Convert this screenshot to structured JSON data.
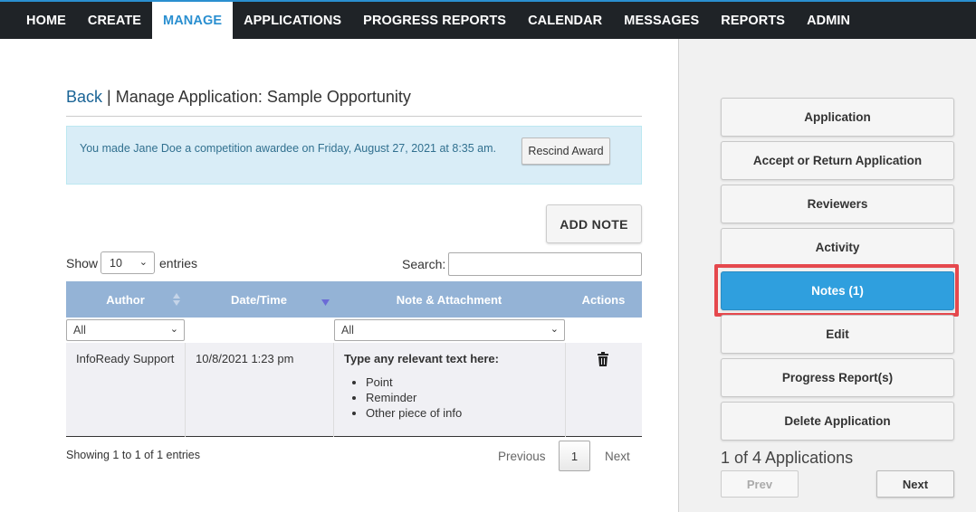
{
  "nav": {
    "items": [
      {
        "label": "HOME",
        "active": false
      },
      {
        "label": "CREATE",
        "active": false
      },
      {
        "label": "MANAGE",
        "active": true
      },
      {
        "label": "APPLICATIONS",
        "active": false
      },
      {
        "label": "PROGRESS REPORTS",
        "active": false
      },
      {
        "label": "CALENDAR",
        "active": false
      },
      {
        "label": "MESSAGES",
        "active": false
      },
      {
        "label": "REPORTS",
        "active": false
      },
      {
        "label": "ADMIN",
        "active": false
      }
    ]
  },
  "page": {
    "back_label": "Back",
    "separator": " | ",
    "title": "Manage Application: Sample Opportunity"
  },
  "alert": {
    "text": "You made Jane Doe a competition awardee on Friday, August 27, 2021 at 8:35 am.",
    "button_label": "Rescind Award"
  },
  "add_note_label": "ADD NOTE",
  "table_controls": {
    "show_label": "Show",
    "page_size": "10",
    "entries_label": "entries",
    "search_label": "Search:",
    "search_value": ""
  },
  "table": {
    "columns": [
      "Author",
      "Date/Time",
      "Note & Attachment",
      "Actions"
    ],
    "filters": {
      "author": "All",
      "note": "All"
    },
    "rows": [
      {
        "author": "InfoReady Support",
        "datetime": "10/8/2021 1:23 pm",
        "note_title": "Type any relevant text here:",
        "note_items": [
          "Point",
          "Reminder",
          "Other piece of info"
        ],
        "action_icon": "trash-icon"
      }
    ]
  },
  "pagination": {
    "info": "Showing 1 to 1 of 1 entries",
    "prev_label": "Previous",
    "current_page": "1",
    "next_label": "Next"
  },
  "sidebar": {
    "buttons": [
      {
        "label": "Application",
        "active": false
      },
      {
        "label": "Accept or Return Application",
        "active": false
      },
      {
        "label": "Reviewers",
        "active": false
      },
      {
        "label": "Activity",
        "active": false
      },
      {
        "label": "Notes (1)",
        "active": true
      },
      {
        "label": "Edit",
        "active": false
      },
      {
        "label": "Progress Report(s)",
        "active": false
      },
      {
        "label": "Delete Application",
        "active": false
      }
    ],
    "counter": "1 of 4 Applications",
    "prev_label": "Prev",
    "next_label": "Next"
  },
  "colors": {
    "nav_bg": "#1f2327",
    "accent": "#2a8fd0",
    "table_header": "#94b3d6",
    "alert_bg": "#d9edf7",
    "active_button": "#2f9fde",
    "highlight": "#e5484d"
  }
}
